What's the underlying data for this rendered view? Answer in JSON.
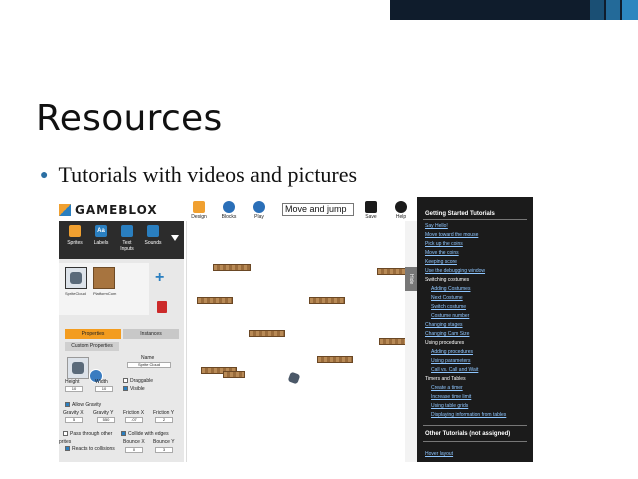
{
  "slide": {
    "title": "Resources",
    "bullet": "Tutorials with videos and pictures"
  },
  "app": {
    "logo_text": "GAMEBLOX",
    "left_tools": [
      {
        "label": "Sprites",
        "icon": "sprite-icon",
        "color": "#f0a030"
      },
      {
        "label": "Labels",
        "icon": "label-icon",
        "color": "#2a7fc0",
        "glyph": "Aa"
      },
      {
        "label": "Text",
        "label2": "Inputs",
        "icon": "text-input-icon",
        "color": "#2a7fc0"
      },
      {
        "label": "Sounds",
        "icon": "sound-icon",
        "color": "#2a7fc0"
      }
    ],
    "sprites": [
      "SpriteCloud",
      "PlatformCom"
    ],
    "tabs": {
      "properties": "Properties",
      "instances": "Instances"
    },
    "custom_properties": "Custom Properties",
    "name_label": "Name",
    "name_value": "Sprite Cloud",
    "height_label": "Height",
    "height_value": "10",
    "width_label": "Width",
    "width_value": "10",
    "draggable_label": "Draggable",
    "visible_label": "Visible",
    "allow_gravity": "Allow Gravity",
    "gravity_x_label": "Gravity X",
    "gravity_x": "5",
    "gravity_y_label": "Gravity Y",
    "gravity_y": "550",
    "friction_x_label": "Friction X",
    "friction_x": ".07",
    "friction_y_label": "Friction Y",
    "friction_y": "2",
    "pass_through": "Pass through other",
    "pass_through2": "prites",
    "collide_edges": "Collide with edges",
    "reacts_collisions": "Reacts to collisions",
    "bounce_x_label": "Bounce X",
    "bounce_x": "0",
    "bounce_y_label": "Bounce Y",
    "bounce_y": "3",
    "top_tools": [
      {
        "label": "Design",
        "icon": "design-icon",
        "color": "#f0a030"
      },
      {
        "label": "Blocks",
        "icon": "blocks-icon",
        "color": "#2a6fb8"
      },
      {
        "label": "Play",
        "icon": "play-icon",
        "color": "#2a6fb8"
      },
      {
        "label": "Save",
        "icon": "save-icon",
        "color": "#1b1b1b"
      },
      {
        "label": "Help",
        "icon": "help-icon",
        "color": "#1b1b1b"
      }
    ],
    "game_name": "Move and jump",
    "hide_label": "Hide"
  },
  "tutorials": {
    "heading": "Getting Started Tutorials",
    "items": [
      {
        "text": "Say Hello!",
        "kind": "link"
      },
      {
        "text": "Move toward the mouse",
        "kind": "link"
      },
      {
        "text": "Pick up the coins",
        "kind": "link"
      },
      {
        "text": "Move the coins",
        "kind": "link"
      },
      {
        "text": "Keeping score",
        "kind": "link"
      },
      {
        "text": "Use the debugging window",
        "kind": "link"
      },
      {
        "text": "Switching costumes",
        "kind": "section"
      },
      {
        "text": "Adding Costumes",
        "kind": "sublink"
      },
      {
        "text": "Next Costume",
        "kind": "sublink"
      },
      {
        "text": "Switch costume",
        "kind": "sublink"
      },
      {
        "text": "Costume number",
        "kind": "sublink"
      },
      {
        "text": "Changing stages",
        "kind": "link"
      },
      {
        "text": "Changing Cam Size",
        "kind": "link"
      },
      {
        "text": "Using procedures",
        "kind": "section"
      },
      {
        "text": "Adding procedures",
        "kind": "sublink"
      },
      {
        "text": "Using parameters",
        "kind": "sublink"
      },
      {
        "text": "Call vs. Call and Wait",
        "kind": "sublink"
      },
      {
        "text": "Timers and Tables",
        "kind": "section"
      },
      {
        "text": "Create a timer",
        "kind": "sublink"
      },
      {
        "text": "Increase time limit",
        "kind": "sublink"
      },
      {
        "text": "Using table grids",
        "kind": "sublink"
      },
      {
        "text": "Displaying information from tables",
        "kind": "sublink"
      }
    ],
    "other_heading": "Other Tutorials (not assigned)",
    "last_item": "Hover layout"
  }
}
